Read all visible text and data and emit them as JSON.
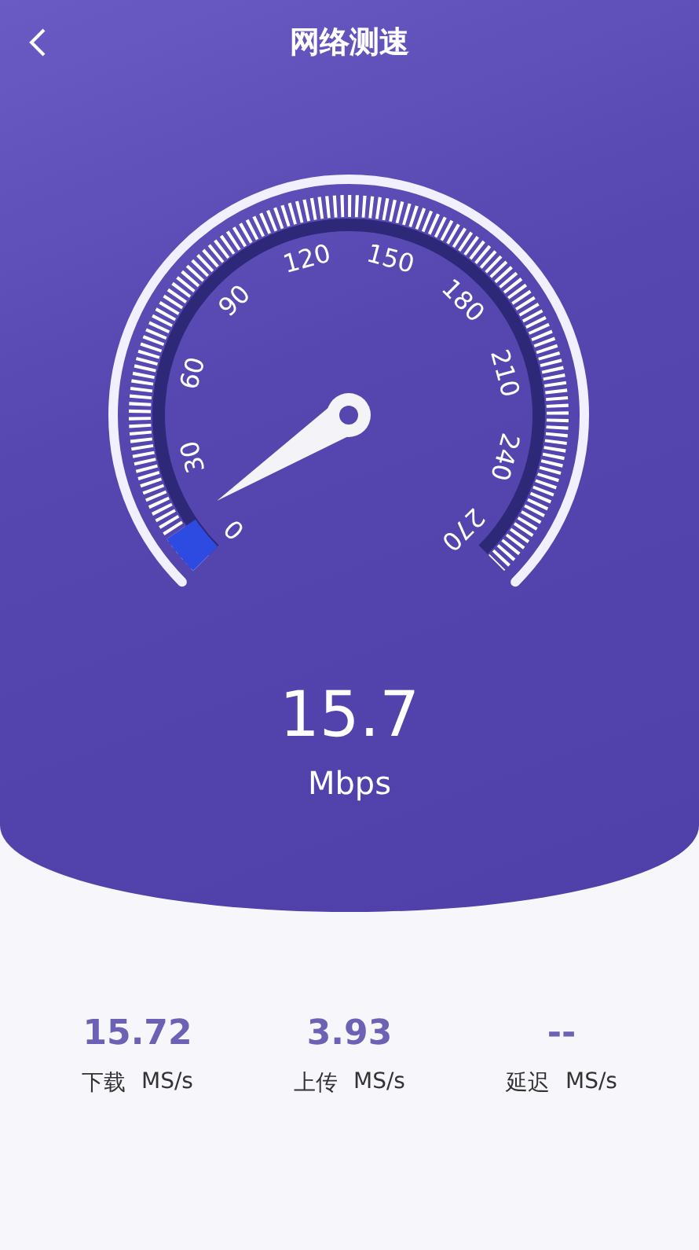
{
  "header": {
    "title": "网络测速"
  },
  "gauge": {
    "scale": [
      "0",
      "30",
      "60",
      "90",
      "120",
      "150",
      "180",
      "210",
      "240",
      "270"
    ]
  },
  "speed": {
    "value": "15.7",
    "unit": "Mbps"
  },
  "stats": [
    {
      "value": "15.72",
      "label": "下载",
      "unit": "MS/s"
    },
    {
      "value": "3.93",
      "label": "上传",
      "unit": "MS/s"
    },
    {
      "value": "--",
      "label": "延迟",
      "unit": "MS/s"
    }
  ]
}
